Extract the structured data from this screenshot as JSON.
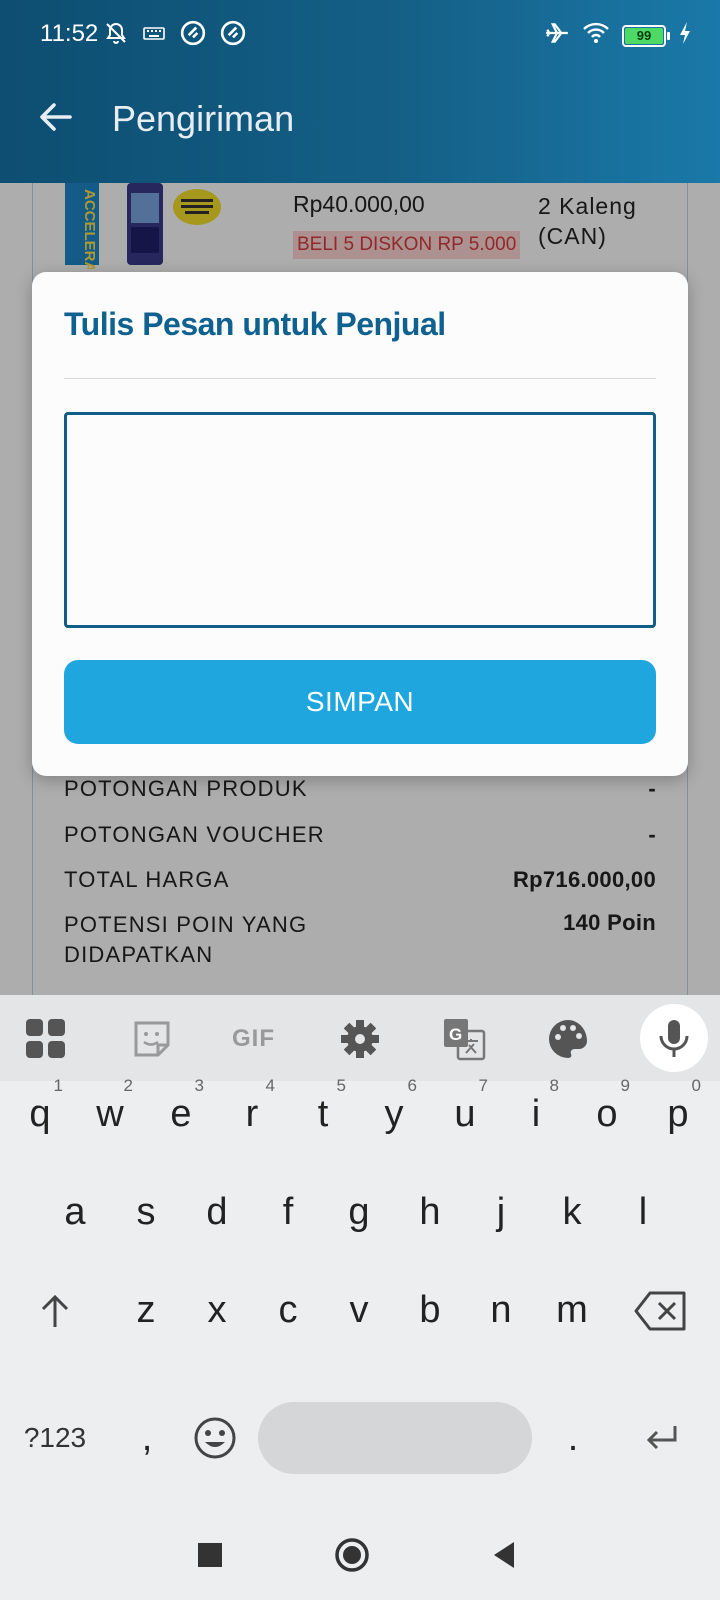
{
  "status_bar": {
    "time": "11:52",
    "battery": "99",
    "icons": [
      "bell-off-icon",
      "keyboard-icon",
      "vpn-icon",
      "vpn-icon",
      "airplane-icon",
      "wifi-icon",
      "battery-icon",
      "charging-icon"
    ]
  },
  "header": {
    "title": "Pengiriman",
    "back_icon": "arrow-left-icon",
    "color": "#145f86"
  },
  "product": {
    "price": "Rp40.000,00",
    "promo": "BELI 5 DISKON RP 5.000",
    "quantity_line1": "2 Kaleng",
    "quantity_line2": "(CAN)",
    "image_brand": "ACCELERAT"
  },
  "summary": [
    {
      "label": "POTONGAN PRODUK",
      "value": "-"
    },
    {
      "label": "POTONGAN VOUCHER",
      "value": "-"
    },
    {
      "label": "TOTAL HARGA",
      "value": "Rp716.000,00"
    },
    {
      "label_line1": "POTENSI POIN YANG",
      "label_line2": "DIDAPATKAN",
      "value": "140 Poin"
    }
  ],
  "dialog": {
    "title": "Tulis Pesan untuk Penjual",
    "input_value": "",
    "save_label": "SIMPAN",
    "accent": "#20a6df"
  },
  "keyboard": {
    "toolbar": [
      "apps-icon",
      "sticker-icon",
      "GIF",
      "settings-icon",
      "translate-icon",
      "palette-icon",
      "microphone-icon"
    ],
    "row1": [
      {
        "k": "q",
        "h": "1"
      },
      {
        "k": "w",
        "h": "2"
      },
      {
        "k": "e",
        "h": "3"
      },
      {
        "k": "r",
        "h": "4"
      },
      {
        "k": "t",
        "h": "5"
      },
      {
        "k": "y",
        "h": "6"
      },
      {
        "k": "u",
        "h": "7"
      },
      {
        "k": "i",
        "h": "8"
      },
      {
        "k": "o",
        "h": "9"
      },
      {
        "k": "p",
        "h": "0"
      }
    ],
    "row2": [
      "a",
      "s",
      "d",
      "f",
      "g",
      "h",
      "j",
      "k",
      "l"
    ],
    "row3": [
      "z",
      "x",
      "c",
      "v",
      "b",
      "n",
      "m"
    ],
    "symbols_label": "?123",
    "comma": ",",
    "period": "."
  },
  "nav": [
    "recents-icon",
    "home-icon",
    "back-icon"
  ]
}
